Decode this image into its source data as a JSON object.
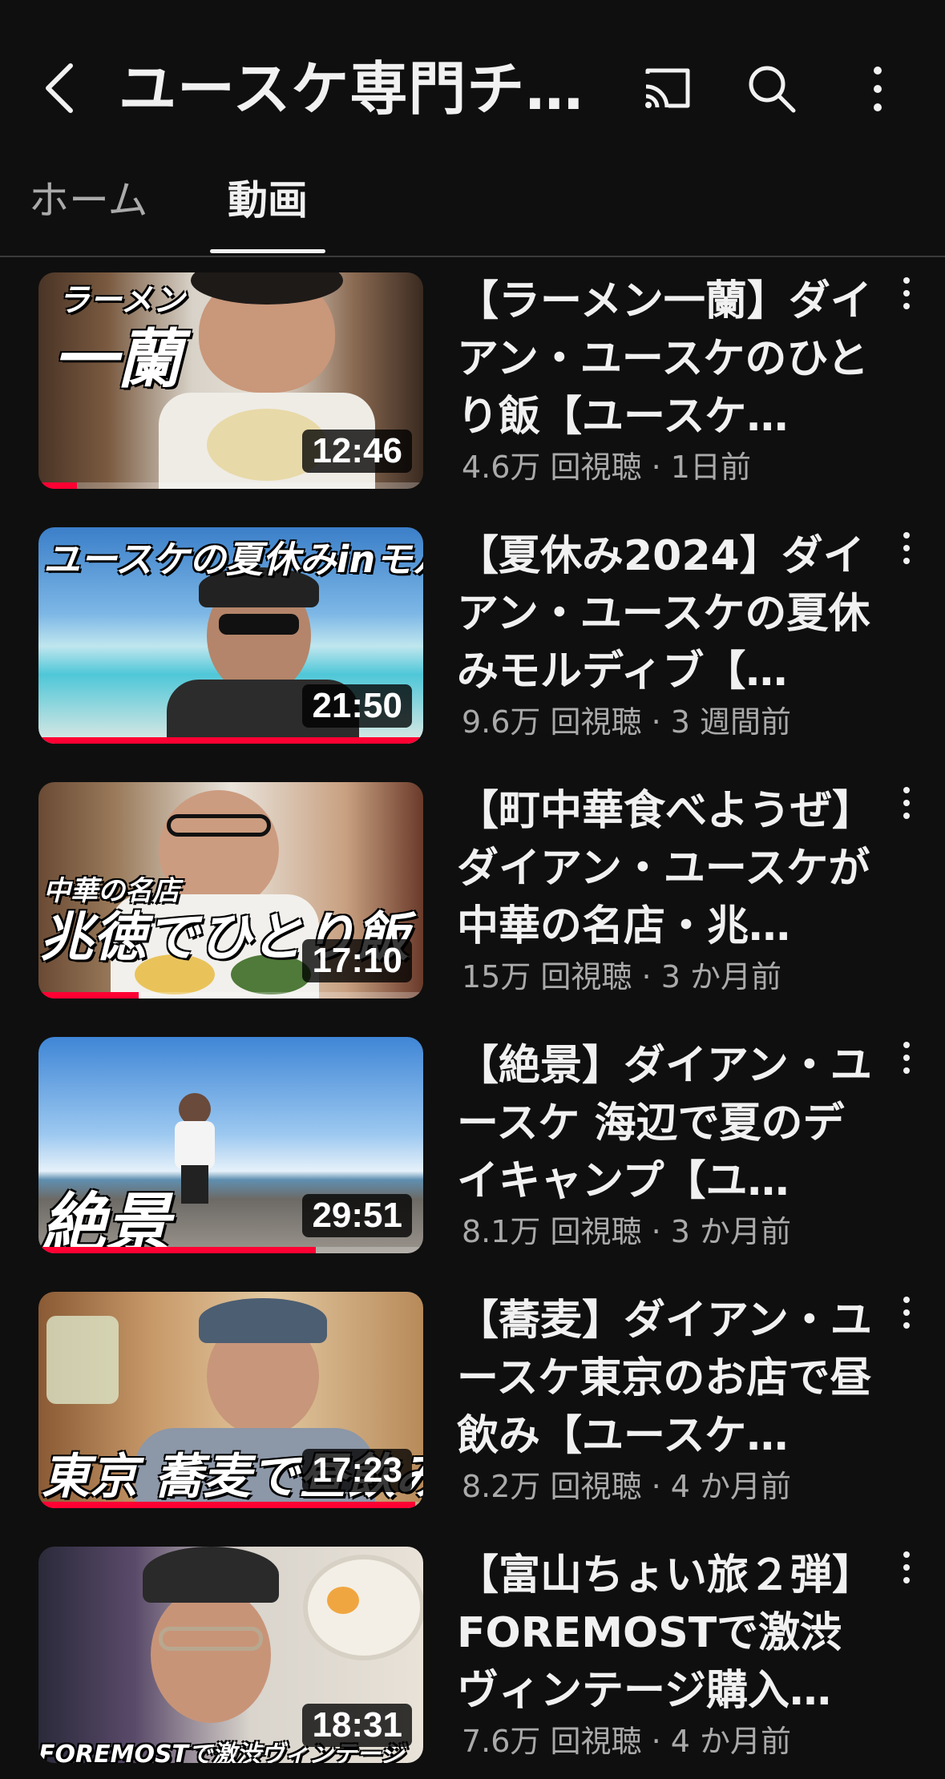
{
  "header": {
    "title": "ユースケ専門チ…",
    "icons": [
      "back-icon",
      "cast-icon",
      "search-icon",
      "more-icon"
    ]
  },
  "tabs": [
    {
      "label": "ホーム",
      "active": false
    },
    {
      "label": "動画",
      "active": true
    }
  ],
  "videos": [
    {
      "title": "【ラーメン一蘭】ダイアン・ユースケのひとり飯【ユースケ…",
      "views": "4.6万 回視聴",
      "age": "1日前",
      "duration": "12:46",
      "overlay_top": "ラーメン",
      "overlay_main": "一蘭",
      "watched": 0.1
    },
    {
      "title": "【夏休み2024】ダイアン・ユースケの夏休みモルディブ【…",
      "views": "9.6万 回視聴",
      "age": "3 週間前",
      "duration": "21:50",
      "overlay_top": "ユースケの夏休みinモルディブ",
      "overlay_main": "",
      "watched": 1.0
    },
    {
      "title": "【町中華食べようぜ】ダイアン・ユースケが中華の名店・兆…",
      "views": "15万 回視聴",
      "age": "3 か月前",
      "duration": "17:10",
      "overlay_top": "中華の名店",
      "overlay_main": "兆徳でひとり飯",
      "watched": 0.26
    },
    {
      "title": "【絶景】ダイアン・ユースケ 海辺で夏のデイキャンプ【ユ…",
      "views": "8.1万 回視聴",
      "age": "3 か月前",
      "duration": "29:51",
      "overlay_top": "",
      "overlay_main": "絶景",
      "watched": 0.72
    },
    {
      "title": "【蕎麦】ダイアン・ユースケ東京のお店で昼飲み【ユースケ…",
      "views": "8.2万 回視聴",
      "age": "4 か月前",
      "duration": "17:23",
      "overlay_top": "",
      "overlay_main": "東京 蕎麦で昼飲み",
      "watched": 0.98
    },
    {
      "title": "【富山ちょい旅２弾】FOREMOSTで激渋ヴィンテージ購入…",
      "views": "7.6万 回視聴",
      "age": "4 か月前",
      "duration": "18:31",
      "overlay_top": "",
      "overlay_main": "FOREMOSTで激渋ヴィンテージ",
      "watched": 0
    }
  ],
  "colors": {
    "background": "#0f0f0f",
    "text_primary": "#f1f1f1",
    "text_secondary": "#aaaaaa",
    "progress": "#ff0033"
  }
}
